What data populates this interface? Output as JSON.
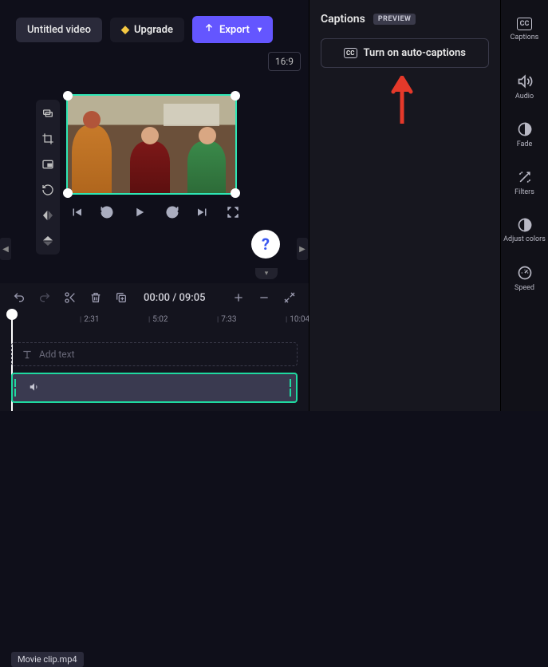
{
  "header": {
    "title": "Untitled video",
    "upgrade": "Upgrade",
    "export": "Export"
  },
  "canvas": {
    "aspect": "16:9"
  },
  "playback": {
    "time_current": "00:00",
    "time_sep": " / ",
    "time_total": "09:05"
  },
  "ruler": {
    "marks": [
      "2:31",
      "5:02",
      "7:33",
      "10:04"
    ]
  },
  "tracks": {
    "text_placeholder": "Add text",
    "clip_name": "Movie clip.mp4"
  },
  "captions_panel": {
    "title": "Captions",
    "badge": "PREVIEW",
    "button": "Turn on auto-captions"
  },
  "side_rail": {
    "items": [
      "Captions",
      "Audio",
      "Fade",
      "Filters",
      "Adjust colors",
      "Speed"
    ]
  }
}
